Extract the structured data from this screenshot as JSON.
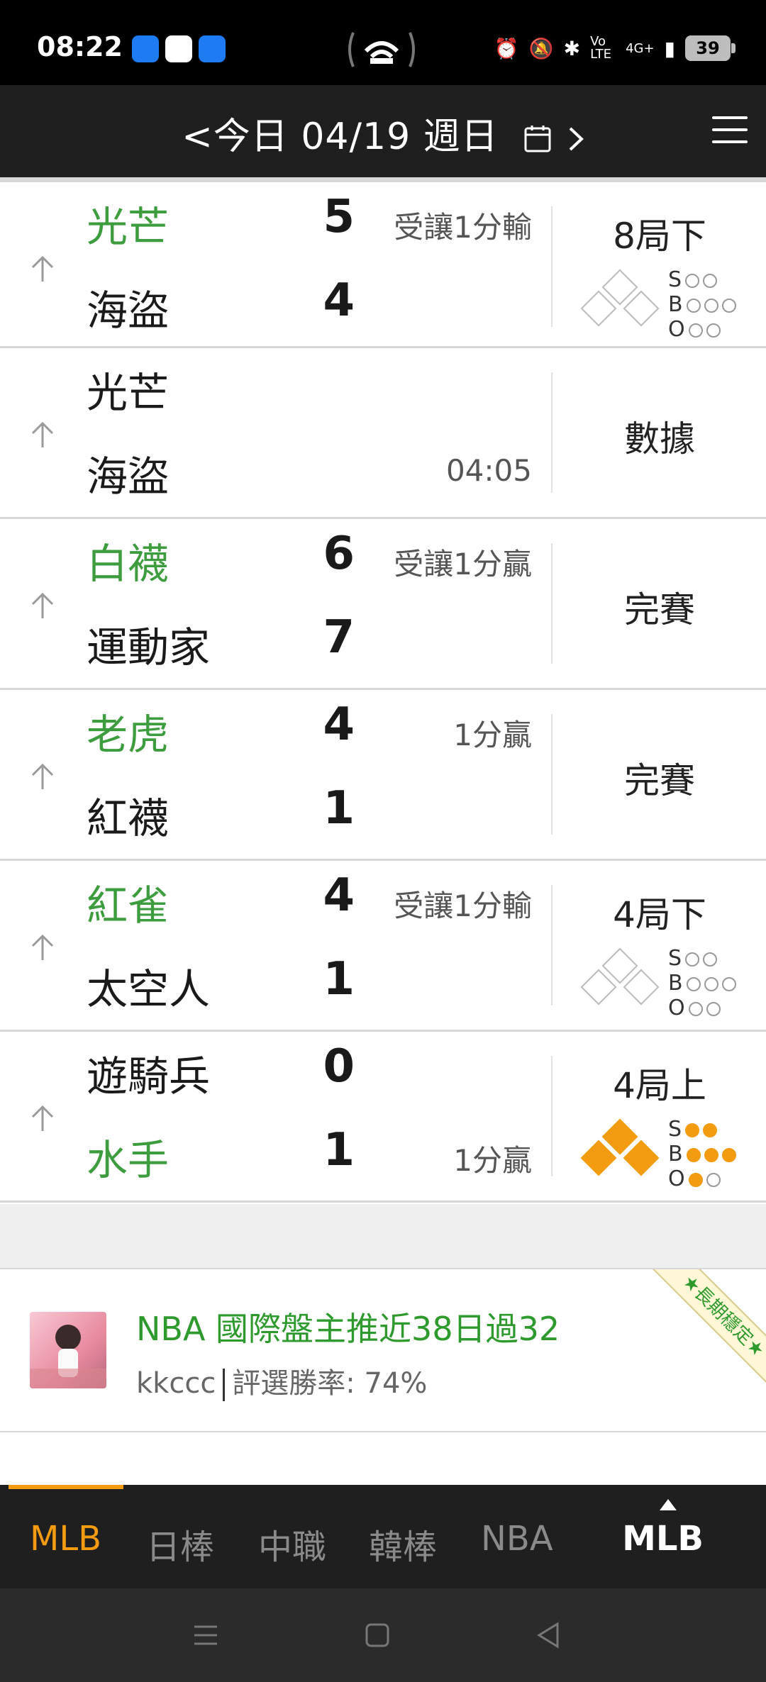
{
  "status_bar": {
    "time": "08:22",
    "network": "4G+",
    "volte": "Vo LTE",
    "battery": "39"
  },
  "header": {
    "date_title": "<今日 04/19 週日",
    "calendar_icon": "calendar-icon",
    "next_icon": "chevron-right-icon",
    "menu_icon": "hamburger-menu-icon"
  },
  "games": [
    {
      "away_team": "光芒",
      "away_score": "5",
      "home_team": "海盜",
      "home_score": "4",
      "winner": "away",
      "odds_top": "受讓1分輸",
      "odds_bottom": "",
      "status": "8局下",
      "live": true,
      "bases": [
        false,
        false,
        false
      ],
      "strikes": 0,
      "balls": 0,
      "outs": 0
    },
    {
      "away_team": "光芒",
      "away_score": "",
      "home_team": "海盜",
      "home_score": "",
      "winner": "",
      "odds_top": "",
      "odds_bottom": "04:05",
      "status": "數據",
      "live": false
    },
    {
      "away_team": "白襪",
      "away_score": "6",
      "home_team": "運動家",
      "home_score": "7",
      "winner": "away",
      "odds_top": "受讓1分贏",
      "odds_bottom": "",
      "status": "完賽",
      "live": false
    },
    {
      "away_team": "老虎",
      "away_score": "4",
      "home_team": "紅襪",
      "home_score": "1",
      "winner": "away",
      "odds_top": "1分贏",
      "odds_bottom": "",
      "status": "完賽",
      "live": false
    },
    {
      "away_team": "紅雀",
      "away_score": "4",
      "home_team": "太空人",
      "home_score": "1",
      "winner": "away",
      "odds_top": "受讓1分輸",
      "odds_bottom": "",
      "status": "4局下",
      "live": true,
      "bases": [
        false,
        false,
        false
      ],
      "strikes": 0,
      "balls": 0,
      "outs": 0
    },
    {
      "away_team": "遊騎兵",
      "away_score": "0",
      "home_team": "水手",
      "home_score": "1",
      "winner": "home",
      "odds_top": "",
      "odds_bottom": "1分贏",
      "status": "4局上",
      "live": true,
      "bases": [
        true,
        true,
        true
      ],
      "strikes": 2,
      "balls": 3,
      "outs": 1
    }
  ],
  "ad": {
    "title": "NBA 國際盤主推近38日過32",
    "user": "kkccc",
    "rate": "評選勝率: 74%",
    "ribbon": "★長期穩定★"
  },
  "tabs": {
    "items": [
      "MLB",
      "日棒",
      "中職",
      "韓棒",
      "NBA"
    ],
    "active_index": 0,
    "current": "MLB"
  },
  "colors": {
    "win_green": "#3d9c3d",
    "accent_orange": "#f39c12",
    "header_bg": "#1f1f1f"
  }
}
